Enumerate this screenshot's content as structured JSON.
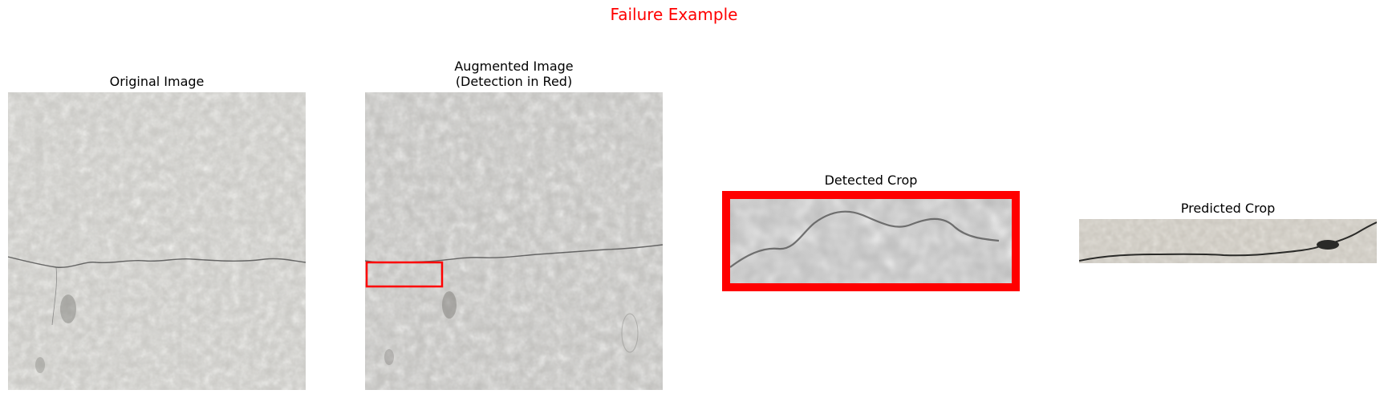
{
  "figure": {
    "suptitle": "Failure Example",
    "suptitle_color": "#ff0000"
  },
  "panels": [
    {
      "title": "Original Image",
      "content": "concrete surface photo with thin horizontal crack"
    },
    {
      "title": "Augmented Image\n(Detection in Red)",
      "content": "augmented concrete surface with red detection box on left edge"
    },
    {
      "title": "Detected Crop",
      "content": "zoomed crop outlined by thick red border"
    },
    {
      "title": "Predicted Crop",
      "content": "thin strip crop showing dark crack line"
    }
  ],
  "colors": {
    "detection_box": "#ff0000",
    "concrete": "#c8c7c3",
    "crack": "#3a3a3a"
  }
}
